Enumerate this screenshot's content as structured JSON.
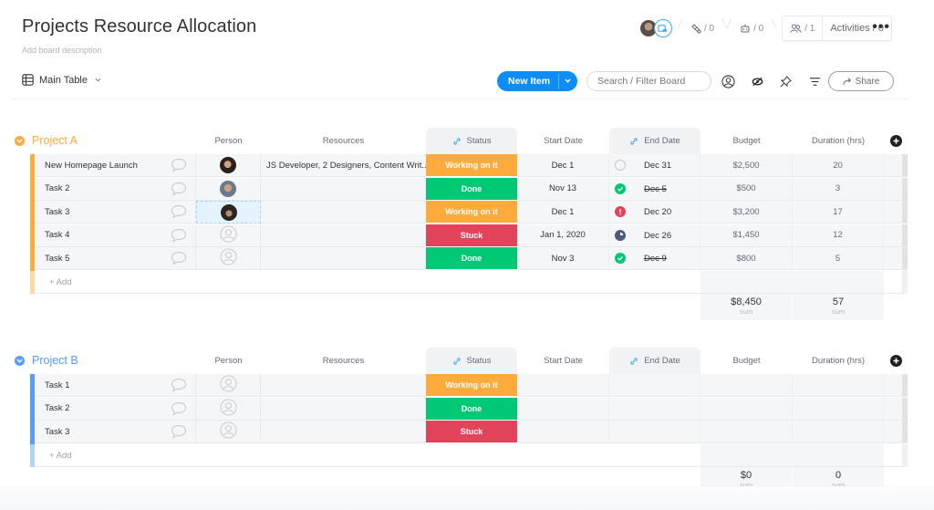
{
  "board": {
    "title": "Projects Resource Allocation",
    "description_placeholder": "Add board description"
  },
  "header": {
    "integrations_count": "/ 0",
    "automations_count": "/ 0",
    "members_count": "/ 1",
    "activities_label": "Activities / 0",
    "more_label": "•••"
  },
  "toolbar": {
    "view_label": "Main Table",
    "new_item_label": "New Item",
    "search_placeholder": "Search / Filter Board",
    "share_label": "Share"
  },
  "columns": {
    "person": "Person",
    "resources": "Resources",
    "status": "Status",
    "start_date": "Start Date",
    "end_date": "End Date",
    "budget": "Budget",
    "duration": "Duration (hrs)"
  },
  "colors": {
    "project_a": "#fdab3d",
    "project_b": "#579bfc",
    "working": "#fdab3d",
    "done": "#00c875",
    "stuck": "#e2445c",
    "primary": "#0d8ef7",
    "overdue_partial": "#4c5a7d"
  },
  "groups": [
    {
      "title": "Project A",
      "color": "#fdab3d",
      "title_color": "#fdab3d",
      "add_label": "+ Add",
      "rows": [
        {
          "name": "New Homepage Launch",
          "person": "avatar-woman",
          "resources": "JS Developer, 2 Designers, Content Writ...",
          "status": "Working on it",
          "status_color": "#fdab3d",
          "start": "Dec 1",
          "end_indicator": "empty",
          "end": "Dec 31",
          "end_done": false,
          "budget": "$2,500",
          "duration": "20"
        },
        {
          "name": "Task 2",
          "person": "avatar-man",
          "resources": "",
          "status": "Done",
          "status_color": "#00c875",
          "start": "Nov 13",
          "end_indicator": "done",
          "end": "Dec 5",
          "end_done": true,
          "budget": "$500",
          "duration": "3"
        },
        {
          "name": "Task 3",
          "person": "avatar-curly",
          "resources": "",
          "status": "Working on it",
          "status_color": "#fdab3d",
          "start": "Dec 1",
          "end_indicator": "overdue",
          "end": "Dec 20",
          "end_done": false,
          "budget": "$3,200",
          "duration": "17"
        },
        {
          "name": "Task 4",
          "person": "empty",
          "resources": "",
          "status": "Stuck",
          "status_color": "#e2445c",
          "start": "Jan 1, 2020",
          "end_indicator": "partial",
          "end": "Dec 26",
          "end_done": false,
          "budget": "$1,450",
          "duration": "12"
        },
        {
          "name": "Task 5",
          "person": "empty",
          "resources": "",
          "status": "Done",
          "status_color": "#00c875",
          "start": "Nov 3",
          "end_indicator": "done",
          "end": "Dec 9",
          "end_done": true,
          "budget": "$800",
          "duration": "5"
        }
      ],
      "sum_budget": "$8,450",
      "sum_duration": "57",
      "sum_label": "sum"
    },
    {
      "title": "Project B",
      "color": "#579bfc",
      "title_color": "#579bfc",
      "add_label": "+ Add",
      "rows": [
        {
          "name": "Task 1",
          "person": "empty",
          "resources": "",
          "status": "Working on it",
          "status_color": "#fdab3d",
          "start": "",
          "end_indicator": "none",
          "end": "",
          "end_done": false,
          "budget": "",
          "duration": ""
        },
        {
          "name": "Task 2",
          "person": "empty",
          "resources": "",
          "status": "Done",
          "status_color": "#00c875",
          "start": "",
          "end_indicator": "none",
          "end": "",
          "end_done": false,
          "budget": "",
          "duration": ""
        },
        {
          "name": "Task 3",
          "person": "empty",
          "resources": "",
          "status": "Stuck",
          "status_color": "#e2445c",
          "start": "",
          "end_indicator": "none",
          "end": "",
          "end_done": false,
          "budget": "",
          "duration": ""
        }
      ],
      "sum_budget": "$0",
      "sum_duration": "0",
      "sum_label": "sum"
    }
  ]
}
